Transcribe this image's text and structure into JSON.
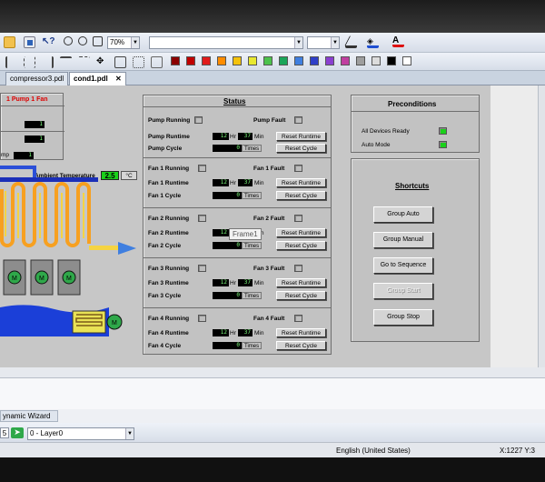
{
  "toolbar": {
    "zoom": "70%",
    "font_combo": "",
    "size_combo": ""
  },
  "swatches": [
    "#8b0000",
    "#c00000",
    "#e11b1b",
    "#ff8c00",
    "#f4c20d",
    "#e8e830",
    "#4cc24c",
    "#1aa55a",
    "#3f7fe0",
    "#2f3fc8",
    "#8a3fd0",
    "#c03fa0",
    "#9e9e9e",
    "#dcdcdc",
    "#000000",
    "#ffffff"
  ],
  "tabs": [
    "compressor3.pdl",
    "cond1.pdl"
  ],
  "left_panel": {
    "title": "1 Pump 1 Fan",
    "values": [
      "1",
      "1",
      "1"
    ],
    "row3_label": "mp"
  },
  "ambient": {
    "label": "Ambient Temperature",
    "value": "2.5",
    "unit": "°C"
  },
  "status": {
    "title": "Status",
    "pump": {
      "running": "Pump Running",
      "fault": "Pump Fault",
      "runtime": "Pump Runtime",
      "cycle": "Pump Cycle",
      "hr_val": "12",
      "hr": "Hr",
      "min_val": "37",
      "min": "Min",
      "cycles": "0",
      "times": "Times",
      "reset_runtime": "Reset Runtime",
      "reset_cycle": "Reset Cycle"
    },
    "fans": [
      {
        "running": "Fan 1 Running",
        "fault": "Fan 1 Fault",
        "runtime": "Fan 1 Runtime",
        "cycle": "Fan 1 Cycle",
        "hr_val": "12",
        "min_val": "37",
        "cycles": "0"
      },
      {
        "running": "Fan 2 Running",
        "fault": "Fan 2 Fault",
        "runtime": "Fan 2 Runtime",
        "cycle": "Fan 2 Cycle",
        "hr_val": "12",
        "min_val": "37",
        "cycles": "0"
      },
      {
        "running": "Fan 3 Running",
        "fault": "Fan 3 Fault",
        "runtime": "Fan 3 Runtime",
        "cycle": "Fan 3 Cycle",
        "hr_val": "12",
        "min_val": "37",
        "cycles": "0"
      },
      {
        "running": "Fan 4 Running",
        "fault": "Fan 4 Fault",
        "runtime": "Fan 4 Runtime",
        "cycle": "Fan 4 Cycle",
        "hr_val": "12",
        "min_val": "37",
        "cycles": "0"
      }
    ],
    "hr": "Hr",
    "min": "Min",
    "times": "Times",
    "reset_runtime": "Reset Runtime",
    "reset_cycle": "Reset Cycle"
  },
  "tooltip": "Frame1",
  "preconditions": {
    "title": "Preconditions",
    "items": [
      {
        "label": "All Devices Ready",
        "on": true
      },
      {
        "label": "Auto Mode",
        "on": true
      }
    ]
  },
  "shortcuts": {
    "title": "Shortcuts",
    "buttons": [
      "Group Auto",
      "Group Manual",
      "Go to Sequence",
      "Group Start",
      "Group Stop"
    ]
  },
  "lower": {
    "wizard_tab": "ynamic Wizard",
    "layer_select": "0 - Layer0",
    "layer_num": "5"
  },
  "statusbar": {
    "language": "English (United States)",
    "coords": "X:1227 Y:3"
  },
  "colors": {
    "led_on": "#19d119",
    "pipe_orange": "#f7a020",
    "pipe_yellow": "#f5d442",
    "water_blue": "#1b3fd8"
  }
}
